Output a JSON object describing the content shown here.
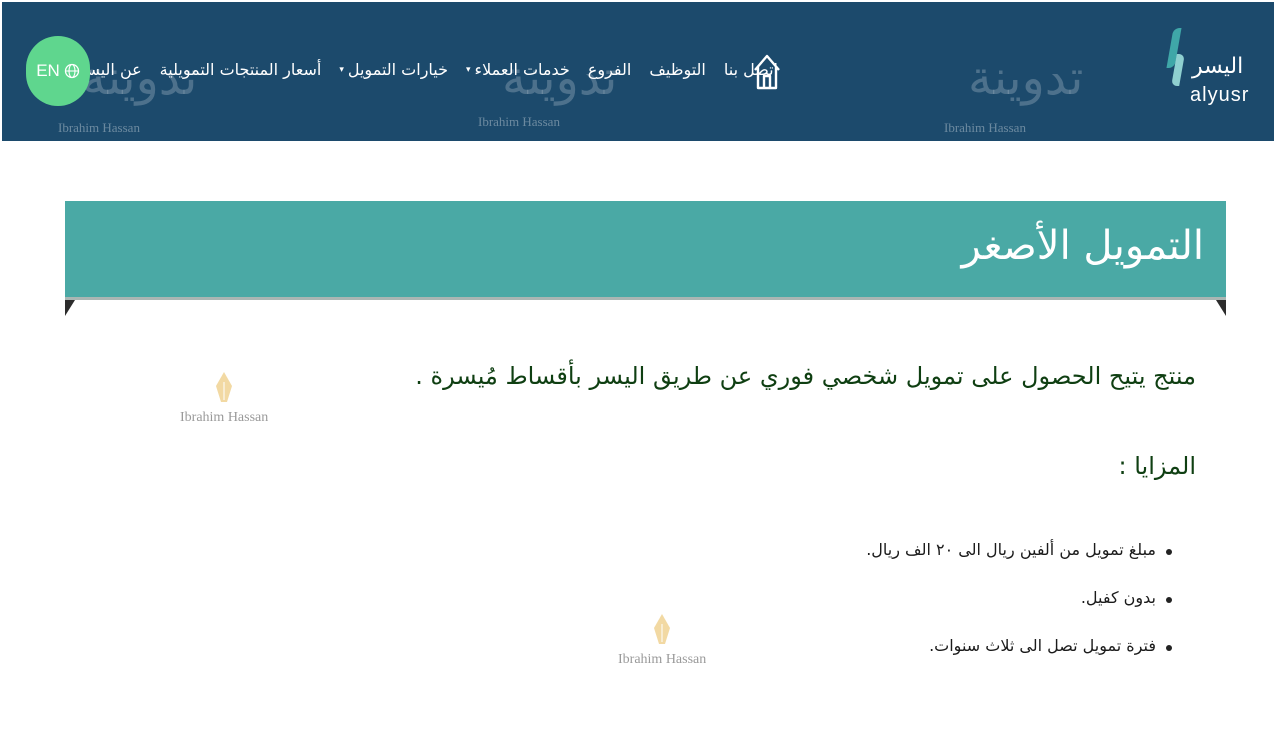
{
  "header": {
    "logo": {
      "arabic": "اليسر",
      "latin": "alyusr"
    },
    "nav": [
      {
        "label": "عن اليسر",
        "has_dropdown": true
      },
      {
        "label": "أسعار المنتجات التمويلية",
        "has_dropdown": false
      },
      {
        "label": "خيارات التمويل",
        "has_dropdown": true
      },
      {
        "label": "خدمات العملاء",
        "has_dropdown": true
      },
      {
        "label": "الفروع",
        "has_dropdown": false
      },
      {
        "label": "التوظيف",
        "has_dropdown": false
      },
      {
        "label": "اتصل بنا",
        "has_dropdown": false
      }
    ],
    "lang_button": "EN",
    "watermark_text": "تدوينة",
    "watermark_caption": "Ibrahim Hassan"
  },
  "banner": {
    "title": "التمويل الأصغر"
  },
  "content": {
    "intro": "منتج يتيح الحصول على تمويل شخصي فوري عن طريق اليسر بأقساط مُيسرة .",
    "features_heading": "المزايا :",
    "features": [
      "مبلغ تمويل من ألفين ريال الى ٢٠ الف ريال.",
      "بدون كفيل.",
      "فترة تمويل تصل الى ثلاث سنوات."
    ],
    "watermark_caption": "Ibrahim Hassan"
  },
  "colors": {
    "header_bg": "#1c4a6c",
    "banner_bg": "#4aa9a5",
    "lang_button_bg": "#5fd68e",
    "heading_text": "#0f3f12"
  }
}
